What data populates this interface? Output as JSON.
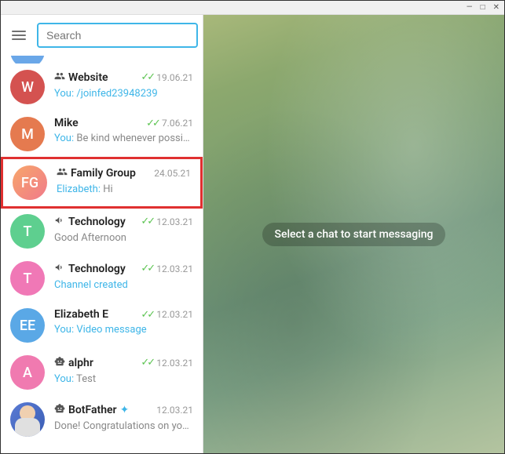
{
  "window": {
    "minimize": "—",
    "maximize": "□",
    "close": "✕"
  },
  "search": {
    "placeholder": "Search"
  },
  "main": {
    "placeholder": "Select a chat to start messaging"
  },
  "chats": [
    {
      "avatar_text": "W",
      "avatar_color": "#d45250",
      "type": "group",
      "name": "Website",
      "read": true,
      "date": "19.06.21",
      "sender": "You:",
      "preview": "/joinfed23948239",
      "preview_link": true,
      "highlighted": false
    },
    {
      "avatar_text": "M",
      "avatar_color": "#e57a4f",
      "type": "direct",
      "name": "Mike",
      "read": true,
      "date": "7.06.21",
      "sender": "You:",
      "preview": "Be kind whenever possi…",
      "preview_link": false,
      "highlighted": false
    },
    {
      "avatar_text": "FG",
      "avatar_color": "linear-gradient(135deg,#f7a66a,#f07a8a)",
      "type": "group",
      "name": "Family Group",
      "read": false,
      "date": "24.05.21",
      "sender": "Elizabeth:",
      "preview": "Hi",
      "preview_link": false,
      "highlighted": true
    },
    {
      "avatar_text": "T",
      "avatar_color": "#5ecf8f",
      "type": "channel",
      "name": "Technology",
      "read": true,
      "date": "12.03.21",
      "sender": "",
      "preview": "Good Afternoon",
      "preview_link": false,
      "highlighted": false
    },
    {
      "avatar_text": "T",
      "avatar_color": "#f078b6",
      "type": "channel",
      "name": "Technology",
      "read": true,
      "date": "12.03.21",
      "sender": "",
      "preview": "Channel created",
      "preview_link": true,
      "highlighted": false
    },
    {
      "avatar_text": "EE",
      "avatar_color": "#5aa8e6",
      "type": "direct",
      "name": "Elizabeth E",
      "read": true,
      "date": "12.03.21",
      "sender": "You:",
      "preview": "Video message",
      "preview_link": true,
      "highlighted": false
    },
    {
      "avatar_text": "A",
      "avatar_color": "#f07ab0",
      "type": "bot",
      "name": "alphr",
      "read": true,
      "date": "12.03.21",
      "sender": "You:",
      "preview": "Test",
      "preview_link": false,
      "highlighted": false
    },
    {
      "avatar_text": "",
      "avatar_color": "bot",
      "type": "bot",
      "name": "BotFather",
      "verified": true,
      "read": false,
      "date": "12.03.21",
      "sender": "",
      "preview": "Done! Congratulations on yo…",
      "preview_link": false,
      "highlighted": false
    }
  ]
}
